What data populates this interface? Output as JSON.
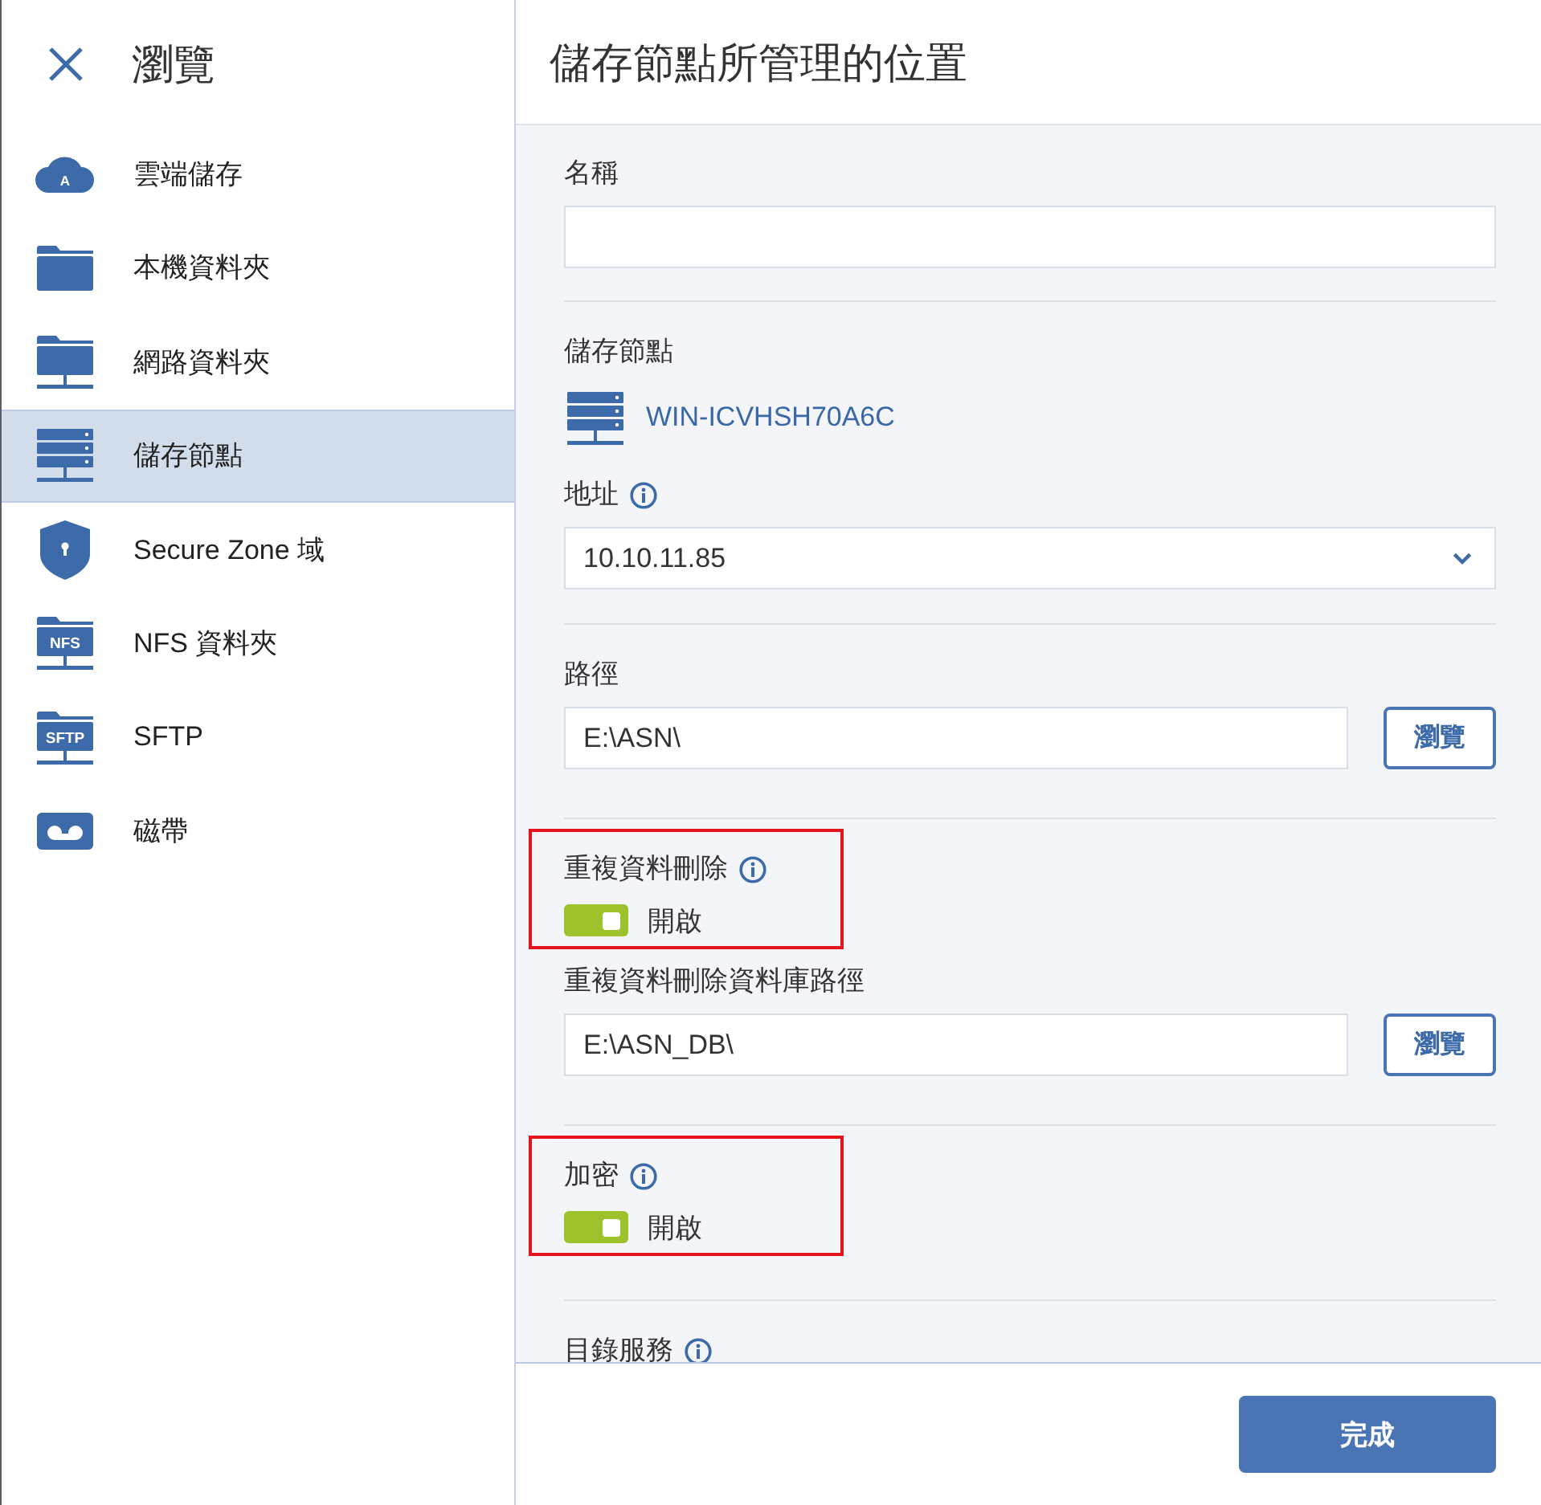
{
  "sidebar": {
    "title": "瀏覽",
    "items": [
      {
        "label": "雲端儲存",
        "kind": "cloud",
        "icon_text": "A",
        "selected": false
      },
      {
        "label": "本機資料夾",
        "kind": "folder",
        "selected": false
      },
      {
        "label": "網路資料夾",
        "kind": "network",
        "selected": false
      },
      {
        "label": "儲存節點",
        "kind": "server",
        "selected": true
      },
      {
        "label": "Secure Zone 域",
        "kind": "shield",
        "selected": false
      },
      {
        "label": "NFS 資料夾",
        "kind": "labeled",
        "icon_text": "NFS",
        "selected": false
      },
      {
        "label": "SFTP",
        "kind": "labeled",
        "icon_text": "SFTP",
        "selected": false
      },
      {
        "label": "磁帶",
        "kind": "tape",
        "selected": false
      }
    ]
  },
  "panel": {
    "title": "儲存節點所管理的位置",
    "sections": [
      {
        "fields": [
          {
            "kind": "text",
            "label": "名稱"
          }
        ]
      },
      {
        "fields": [
          {
            "kind": "node",
            "label": "儲存節點",
            "value": "WIN-ICVHSH70A6C"
          },
          {
            "kind": "select",
            "label": "地址",
            "value": "10.10.11.85",
            "info": true
          }
        ]
      },
      {
        "fields": [
          {
            "kind": "path",
            "label": "路徑",
            "value": "E:\\ASN\\",
            "button": "瀏覽"
          }
        ]
      },
      {
        "fields": [
          {
            "kind": "toggle",
            "label": "重複資料刪除",
            "on": true,
            "state": "開啟",
            "info": true,
            "highlighted": true
          },
          {
            "kind": "path",
            "label": "重複資料刪除資料庫路徑",
            "value": "E:\\ASN_DB\\",
            "button": "瀏覽"
          }
        ]
      },
      {
        "fields": [
          {
            "kind": "toggle",
            "label": "加密",
            "on": true,
            "state": "開啟",
            "info": true,
            "highlighted": true
          }
        ]
      },
      {
        "fields": [
          {
            "kind": "heading",
            "label": "目錄服務",
            "info": true
          }
        ]
      }
    ]
  },
  "footer": {
    "button": "完成"
  }
}
